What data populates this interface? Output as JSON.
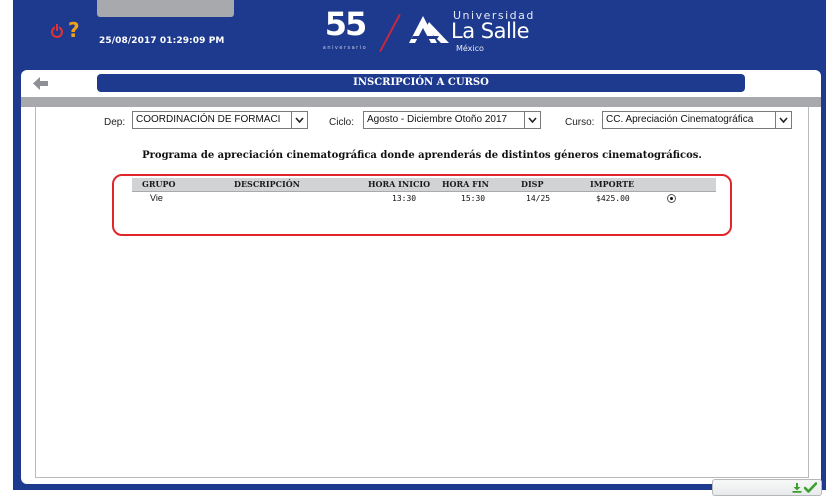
{
  "header": {
    "datetime": "25/08/2017 01:29:09 PM",
    "help_glyph": "?",
    "anniversary": {
      "number": "55",
      "label": "aniversario"
    },
    "university": {
      "line1": "Universidad",
      "name": "La Salle",
      "country": "México"
    }
  },
  "page": {
    "title": "INSCRIPCIÓN A CURSO"
  },
  "filters": {
    "dep": {
      "label": "Dep:",
      "value": "COORDINACIÓN DE FORMACI"
    },
    "ciclo": {
      "label": "Ciclo:",
      "value": "Agosto - Diciembre Otoño 2017"
    },
    "curso": {
      "label": "Curso:",
      "value": "CC. Apreciación Cinematográfica"
    }
  },
  "course_description": "Programa de apreciación cinematográfica donde aprenderás de distintos géneros cinematográficos.",
  "table": {
    "columns": [
      "GRUPO",
      "DESCRIPCIÓN",
      "HORA INICIO",
      "HORA FIN",
      "DISP",
      "IMPORTE"
    ],
    "rows": [
      {
        "grupo": "Vie",
        "descripcion": "",
        "hora_inicio": "13:30",
        "hora_fin": "15:30",
        "disp": "14/25",
        "importe": "$425.00",
        "selected": true
      }
    ]
  },
  "colors": {
    "brand_blue": "#1d3a8e",
    "band_gray": "#a7a9ad",
    "highlight_red": "#e0252b",
    "confirm_green": "#3aa12e"
  },
  "icons": {
    "power": "power-icon",
    "help": "help-icon",
    "back": "back-arrow-icon",
    "download": "download-icon",
    "confirm": "check-icon"
  }
}
